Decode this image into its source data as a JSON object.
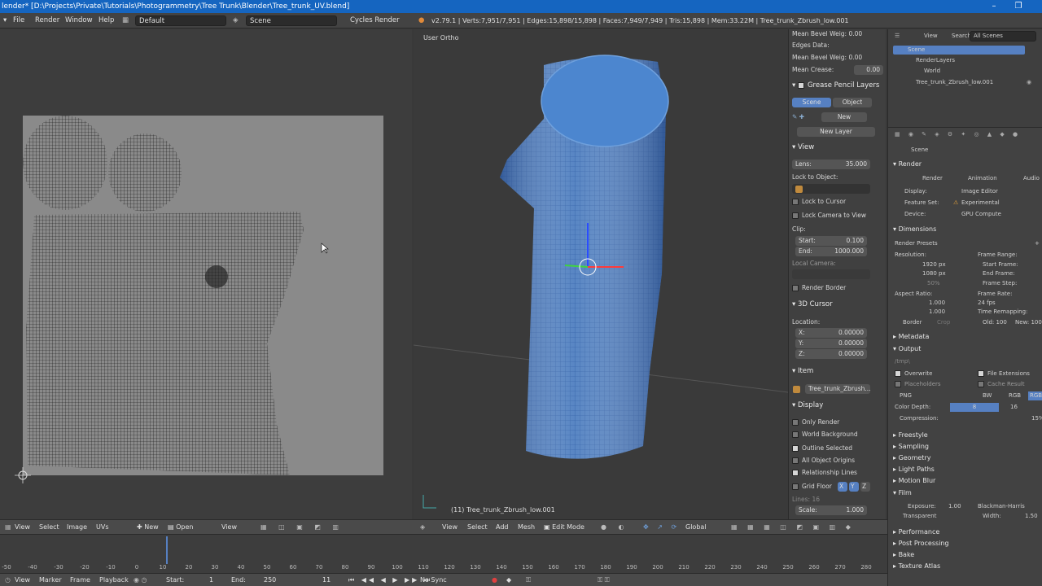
{
  "titlebar": {
    "title": "lender* [D:\\Projects\\Private\\Tutorials\\Photogrammetry\\Tree Trunk\\Blender\\Tree_trunk_UV.blend]",
    "minimize": "–",
    "maximize": "❐"
  },
  "topbar": {
    "menus": [
      "File",
      "Render",
      "Window",
      "Help"
    ],
    "layout": "Default",
    "scene": "Scene",
    "engine": "Cycles Render",
    "stats": "v2.79.1 | Verts:7,951/7,951 | Edges:15,898/15,898 | Faces:7,949/7,949 | Tris:15,898 | Mem:33.22M | Tree_trunk_Zbrush_low.001"
  },
  "viewport": {
    "label": "User Ortho",
    "object_label": "(11) Tree_trunk_Zbrush_low.001"
  },
  "npanel": {
    "mean_bevel_weight_label": "Mean Bevel Weig: 0.00",
    "edges_data_label": "Edges Data:",
    "mean_bevel_weight_label2": "Mean Bevel Weig: 0.00",
    "mean_crease_label": "Mean Crease:",
    "mean_crease_value": "0.00",
    "grease_pencil_header": "Grease Pencil Layers",
    "gp_scene": "Scene",
    "gp_object": "Object",
    "gp_new": "New",
    "gp_new_layer": "New Layer",
    "view_header": "View",
    "lens_label": "Lens:",
    "lens_value": "35.000",
    "lock_to_object": "Lock to Object:",
    "lock_to_cursor": "Lock to Cursor",
    "lock_camera": "Lock Camera to View",
    "clip_label": "Clip:",
    "clip_start_label": "Start:",
    "clip_start_value": "0.100",
    "clip_end_label": "End:",
    "clip_end_value": "1000.000",
    "local_camera": "Local Camera:",
    "render_border": "Render Border",
    "cursor_header": "3D Cursor",
    "location_label": "Location:",
    "x_label": "X:",
    "x_value": "0.00000",
    "y_label": "Y:",
    "y_value": "0.00000",
    "z_label": "Z:",
    "z_value": "0.00000",
    "item_header": "Item",
    "item_name": "Tree_trunk_Zbrush...",
    "display_header": "Display",
    "only_render": "Only Render",
    "world_background": "World Background",
    "outline_selected": "Outline Selected",
    "all_object_origins": "All Object Origins",
    "relationship_lines": "Relationship Lines",
    "grid_floor": "Grid Floor",
    "grid_x": "X",
    "grid_y": "Y",
    "grid_z": "Z",
    "lines_label": "Lines:",
    "lines_value": "16",
    "scale_label": "Scale:",
    "scale_value": "1.000"
  },
  "outliner": {
    "view": "View",
    "search": "Search",
    "filter": "All Scenes",
    "items": [
      "Scene",
      "RenderLayers",
      "World",
      "Tree_trunk_Zbrush_low.001"
    ]
  },
  "props": {
    "breadcrumb": "Scene",
    "render_header": "Render",
    "render_btn": "Render",
    "animation_btn": "Animation",
    "audio_btn": "Audio",
    "display_label": "Display:",
    "display_value": "Image Editor",
    "feature_label": "Feature Set:",
    "feature_value": "Experimental",
    "device_label": "Device:",
    "device_value": "GPU Compute",
    "dimensions": "Dimensions",
    "render_presets": "Render Presets",
    "resolution": "Resolution:",
    "res_x": "1920 px",
    "res_y": "1080 px",
    "res_pct": "50%",
    "frame_range": "Frame Range:",
    "start_frame": "Start Frame:",
    "end_frame": "End Frame:",
    "frame_step": "Frame Step:",
    "aspect_ratio": "Aspect Ratio:",
    "aspect_x": "1.000",
    "aspect_y": "1.000",
    "frame_rate": "Frame Rate:",
    "fps": "24 fps",
    "time_remapping": "Time Remapping:",
    "old_value": "Old: 100",
    "new_value": "New: 100",
    "border": "Border",
    "crop": "Crop",
    "metadata": "Metadata",
    "output": "Output",
    "output_path": "/tmp\\",
    "overwrite": "Overwrite",
    "file_extensions": "File Extensions",
    "placeholders": "Placeholders",
    "cache_result": "Cache Result",
    "format": "PNG",
    "bw": "BW",
    "rgb": "RGB",
    "rgba": "RGBA",
    "color_depth": "Color Depth:",
    "depth_8": "8",
    "depth_16": "16",
    "compression": "Compression:",
    "compression_value": "15%",
    "sections_a": [
      "Freestyle",
      "Sampling",
      "Geometry",
      "Light Paths",
      "Motion Blur"
    ],
    "film": "Film",
    "exposure": "Exposure:",
    "exposure_value": "1.00",
    "filter": "Blackman-Harris",
    "transparent": "Transparent",
    "width": "Width:",
    "width_value": "1.50",
    "sections_b": [
      "Performance",
      "Post Processing",
      "Bake",
      "Texture Atlas"
    ]
  },
  "uv_header": {
    "items": [
      "View",
      "Select",
      "Image",
      "UVs"
    ],
    "new": "New",
    "open": "Open",
    "view2": "View"
  },
  "view3d_header": {
    "items": [
      "View",
      "Select",
      "Add",
      "Mesh"
    ],
    "mode": "Edit Mode",
    "orientation": "Global"
  },
  "timeline": {
    "ticks": [
      "-50",
      "-40",
      "-30",
      "-20",
      "-10",
      "0",
      "10",
      "20",
      "30",
      "40",
      "50",
      "60",
      "70",
      "80",
      "90",
      "100",
      "110",
      "120",
      "130",
      "140",
      "150",
      "160",
      "170",
      "180",
      "190",
      "200",
      "210",
      "220",
      "230",
      "240",
      "250",
      "260",
      "270",
      "280"
    ],
    "current": "11"
  },
  "timebar": {
    "items": [
      "View",
      "Marker",
      "Frame",
      "Playback"
    ],
    "start_label": "Start:",
    "start_value": "1",
    "end_label": "End:",
    "end_value": "250",
    "current": "11",
    "sync": "No Sync"
  }
}
